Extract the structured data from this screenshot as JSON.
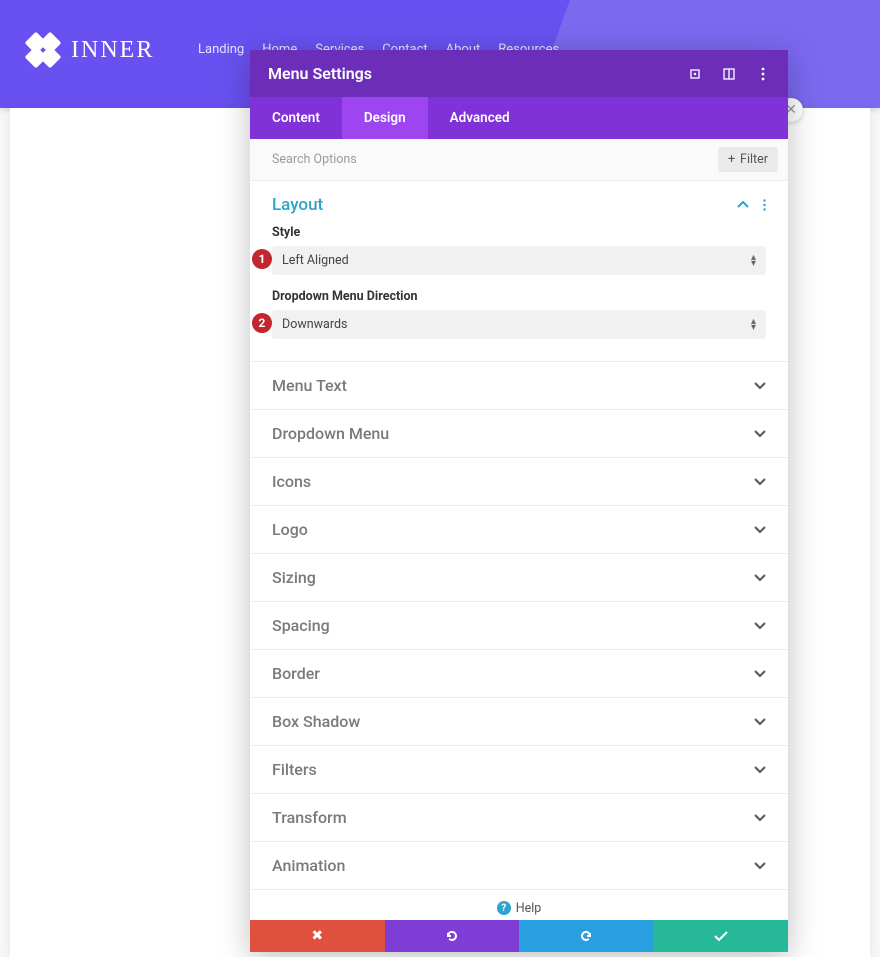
{
  "brand": {
    "name": "INNER"
  },
  "nav": [
    "Landing",
    "Home",
    "Services",
    "Contact",
    "About",
    "Resources"
  ],
  "modal": {
    "title": "Menu Settings",
    "tabs": [
      {
        "label": "Content",
        "active": false
      },
      {
        "label": "Design",
        "active": true
      },
      {
        "label": "Advanced",
        "active": false
      }
    ],
    "search_placeholder": "Search Options",
    "filter_label": "Filter",
    "layout": {
      "title": "Layout",
      "style_label": "Style",
      "style_value": "Left Aligned",
      "style_badge": "1",
      "dropdown_label": "Dropdown Menu Direction",
      "dropdown_value": "Downwards",
      "dropdown_badge": "2"
    },
    "sections": [
      "Menu Text",
      "Dropdown Menu",
      "Icons",
      "Logo",
      "Sizing",
      "Spacing",
      "Border",
      "Box Shadow",
      "Filters",
      "Transform",
      "Animation"
    ],
    "help_label": "Help"
  }
}
